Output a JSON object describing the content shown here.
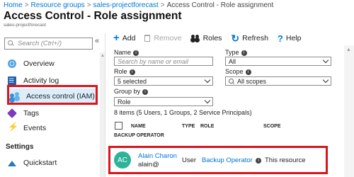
{
  "breadcrumb": [
    "Home",
    "Resource groups",
    "sales-projectforecast",
    "Access Control - Role assignment"
  ],
  "breadcrumb_sep": ">",
  "page": {
    "title": "Access Control - Role assignment",
    "subtitle": "sales-projectforecast"
  },
  "sidebar": {
    "search_placeholder": "Search (Ctrl+/)",
    "collapse_glyph": "«",
    "items": [
      {
        "label": "Overview",
        "icon": "overview-icon"
      },
      {
        "label": "Activity log",
        "icon": "activity-log-icon"
      },
      {
        "label": "Access control (IAM)",
        "icon": "iam-icon",
        "active": true
      },
      {
        "label": "Tags",
        "icon": "tag-icon"
      },
      {
        "label": "Events",
        "icon": "lightning-icon"
      }
    ],
    "section": "Settings",
    "settings_items": [
      {
        "label": "Quickstart",
        "icon": "quickstart-icon"
      }
    ]
  },
  "toolbar": {
    "add": "Add",
    "remove": "Remove",
    "roles": "Roles",
    "refresh": "Refresh",
    "help": "Help"
  },
  "filters": {
    "name_label": "Name",
    "name_placeholder": "Search by name or email",
    "type_label": "Type",
    "type_value": "All",
    "role_label": "Role",
    "role_value": "5 selected",
    "scope_label": "Scope",
    "scope_value": "All scopes",
    "groupby_label": "Group by",
    "groupby_value": "Role"
  },
  "results": {
    "count_text": "8 items (5 Users, 1 Groups, 2 Service Principals)",
    "columns": [
      "NAME",
      "TYPE",
      "ROLE",
      "SCOPE"
    ],
    "group_header": "BACKUP OPERATOR",
    "rows": [
      {
        "initials": "AC",
        "name": "Alain Charon",
        "sub": "alain@",
        "type": "User",
        "role": "Backup Operator",
        "scope": "This resource"
      }
    ]
  },
  "colors": {
    "accent": "#0078d4",
    "highlight": "#d9151d",
    "avatar": "#2db39a",
    "active_bg": "#dceefb"
  }
}
